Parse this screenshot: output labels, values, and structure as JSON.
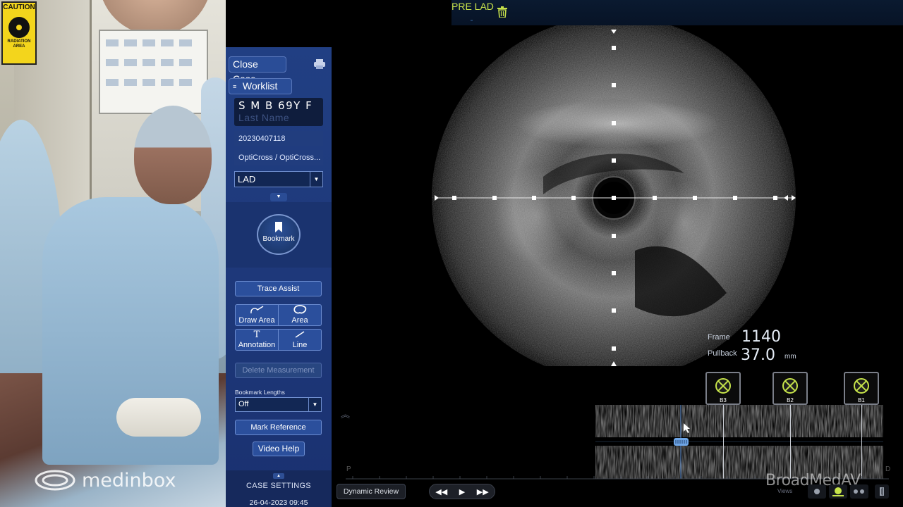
{
  "camera": {
    "caution_sign": {
      "header": "CAUTION",
      "footer": "RADIATION AREA"
    },
    "logo_text": "medinbox"
  },
  "console": {
    "close_case_label": "Close Case",
    "worklist_label": "Worklist",
    "patient": {
      "name": "S M B 69Y F",
      "last_name_placeholder": "Last Name",
      "case_id": "20230407118",
      "catheter": "OptiCross / OptiCross..."
    },
    "vessel_select": {
      "value": "LAD"
    },
    "bookmark_label": "Bookmark",
    "trace_assist_label": "Trace Assist",
    "tools": [
      {
        "label": "Draw Area",
        "icon": "draw-area-icon"
      },
      {
        "label": "Area",
        "icon": "area-icon"
      },
      {
        "label": "Annotation",
        "icon": "annotation-icon",
        "glyph": "T"
      },
      {
        "label": "Line",
        "icon": "line-icon"
      }
    ],
    "delete_measurement_label": "Delete Measurement",
    "bookmark_lengths": {
      "label": "Bookmark Lengths",
      "value": "Off"
    },
    "mark_reference_label": "Mark Reference",
    "video_help_label": "Video Help",
    "case_settings_label": "CASE SETTINGS",
    "datetime": "26-04-2023 09:45"
  },
  "viewer": {
    "run_label": "PRE LAD",
    "frame": {
      "label": "Frame",
      "value": "1140"
    },
    "pullback": {
      "label": "Pullback",
      "value": "37.0",
      "unit": "mm"
    },
    "bookmarks": [
      {
        "label": "B3"
      },
      {
        "label": "B2"
      },
      {
        "label": "B1"
      }
    ],
    "timeline": {
      "start_marker": "P",
      "end_marker": "D"
    },
    "dynamic_review_label": "Dynamic Review",
    "playback": {
      "rewind": "◀◀",
      "play": "▶",
      "forward": "▶▶"
    },
    "brand": "BroadMedAV",
    "views_label": "Views",
    "colors": {
      "accent_green": "#c6e34a",
      "console_blue": "#1d3778"
    }
  }
}
